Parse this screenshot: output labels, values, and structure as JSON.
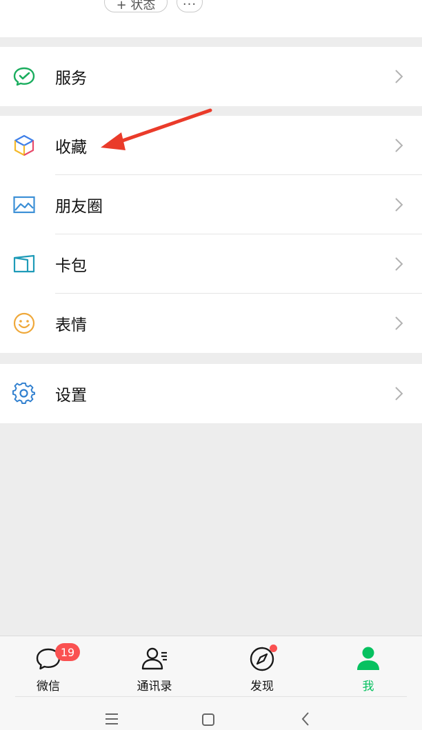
{
  "profile": {
    "status_label": "+ 状态",
    "more_label": "···"
  },
  "menu": {
    "services": {
      "label": "服务",
      "icon": "wechat-pay-check-icon"
    },
    "favorites": {
      "label": "收藏",
      "icon": "cube-icon"
    },
    "moments": {
      "label": "朋友圈",
      "icon": "picture-icon"
    },
    "cards": {
      "label": "卡包",
      "icon": "card-icon"
    },
    "stickers": {
      "label": "表情",
      "icon": "smiley-icon"
    },
    "settings": {
      "label": "设置",
      "icon": "gear-icon"
    }
  },
  "tabbar": {
    "chats": {
      "label": "微信",
      "badge": "19",
      "icon": "chat-bubble-icon"
    },
    "contacts": {
      "label": "通讯录",
      "icon": "contacts-icon"
    },
    "discover": {
      "label": "发现",
      "icon": "compass-icon"
    },
    "me": {
      "label": "我",
      "icon": "person-icon",
      "active": true
    }
  },
  "colors": {
    "accent": "#07c160",
    "badge": "#fa5151",
    "annotation_arrow": "#ea3b2a",
    "background": "#ededed"
  }
}
